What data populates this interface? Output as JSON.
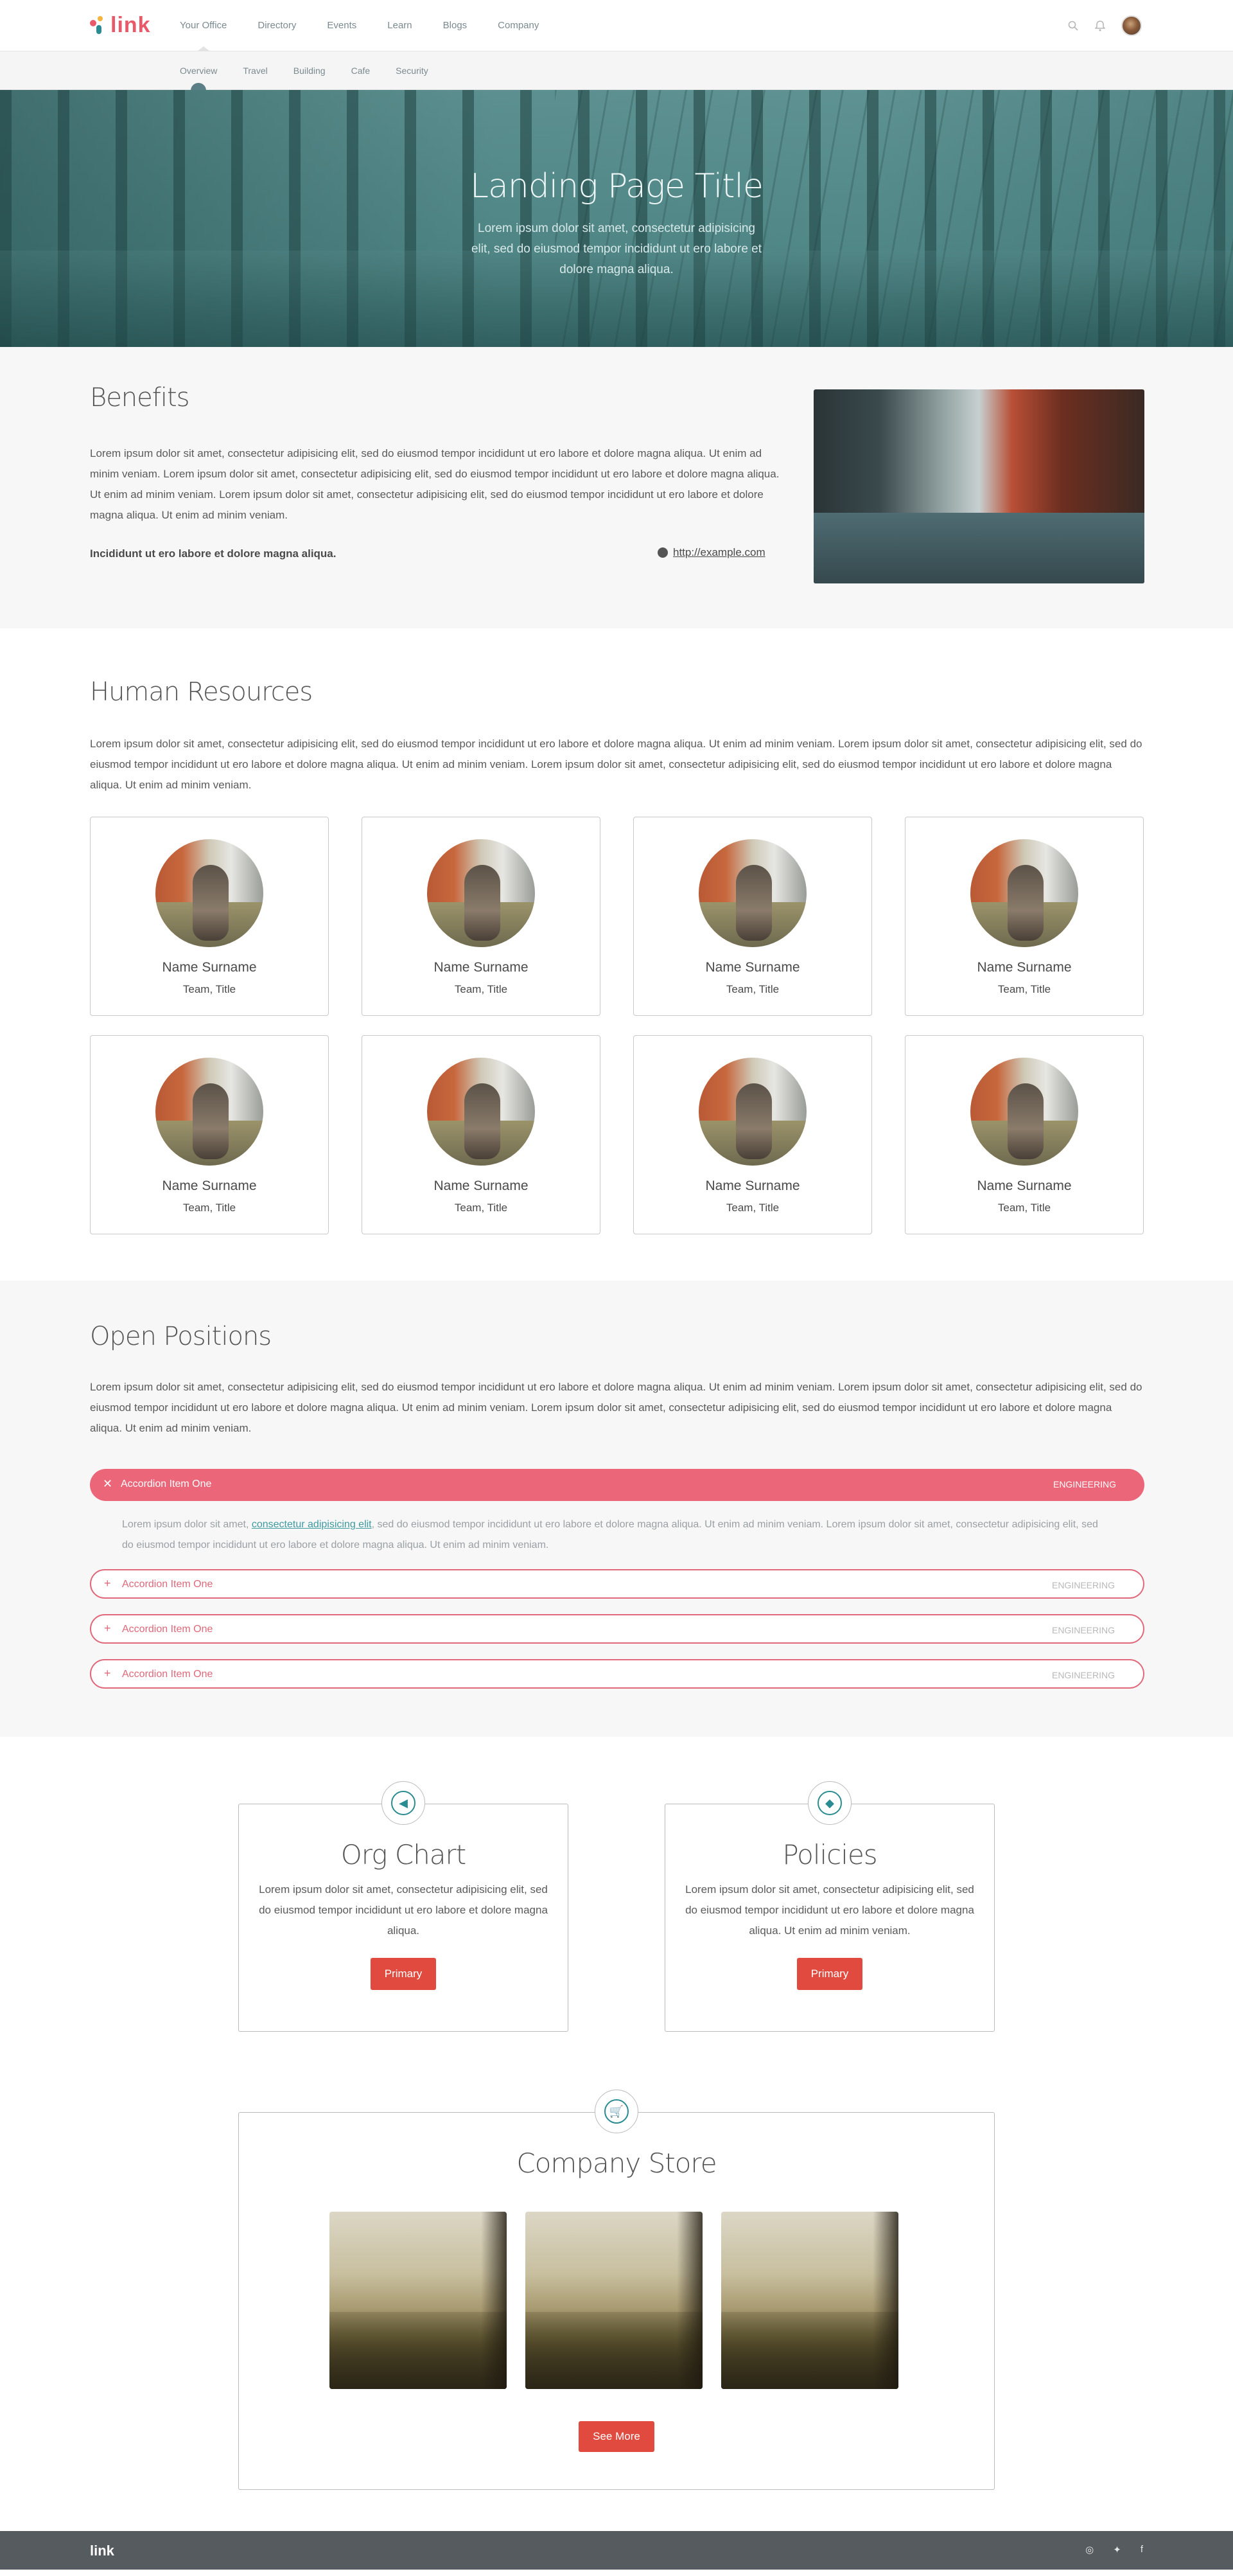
{
  "header": {
    "logo": "link",
    "nav": [
      "Your Office",
      "Directory",
      "Events",
      "Learn",
      "Blogs",
      "Company"
    ],
    "subnav": [
      "Overview",
      "Travel",
      "Building",
      "Cafe",
      "Security"
    ]
  },
  "hero": {
    "title": "Landing Page Title",
    "subtitle": "Lorem ipsum dolor sit amet, consectetur adipisicing elit, sed do eiusmod tempor incididunt ut ero labore et dolore magna aliqua."
  },
  "benefits": {
    "title": "Benefits",
    "text": "Lorem ipsum dolor sit amet, consectetur adipisicing elit, sed do eiusmod tempor incididunt ut ero labore et dolore magna aliqua. Ut enim ad minim veniam. Lorem ipsum dolor sit amet, consectetur adipisicing elit, sed do eiusmod tempor incididunt ut ero labore et dolore magna aliqua. Ut enim ad minim veniam. Lorem ipsum dolor sit amet, consectetur adipisicing elit, sed do eiusmod tempor incididunt ut ero labore et dolore magna aliqua. Ut enim ad minim veniam.",
    "bold": "Incididunt ut ero labore et dolore magna aliqua.",
    "link": "http://example.com"
  },
  "hr": {
    "title": "Human Resources",
    "text": "Lorem ipsum dolor sit amet, consectetur adipisicing elit, sed do eiusmod tempor incididunt ut ero labore et dolore magna aliqua. Ut enim ad minim veniam. Lorem ipsum dolor sit amet, consectetur adipisicing elit, sed do eiusmod tempor incididunt ut ero labore et dolore magna aliqua. Ut enim ad minim veniam. Lorem ipsum dolor sit amet, consectetur adipisicing elit, sed do eiusmod tempor incididunt ut ero labore et dolore magna aliqua. Ut enim ad minim veniam.",
    "people": [
      {
        "name": "Name Surname",
        "title": "Team, Title"
      },
      {
        "name": "Name Surname",
        "title": "Team, Title"
      },
      {
        "name": "Name Surname",
        "title": "Team, Title"
      },
      {
        "name": "Name Surname",
        "title": "Team, Title"
      },
      {
        "name": "Name Surname",
        "title": "Team, Title"
      },
      {
        "name": "Name Surname",
        "title": "Team, Title"
      },
      {
        "name": "Name Surname",
        "title": "Team, Title"
      },
      {
        "name": "Name Surname",
        "title": "Team, Title"
      }
    ]
  },
  "positions": {
    "title": "Open Positions",
    "text": "Lorem ipsum dolor sit amet, consectetur adipisicing elit, sed do eiusmod tempor incididunt ut ero labore et dolore magna aliqua. Ut enim ad minim veniam. Lorem ipsum dolor sit amet, consectetur adipisicing elit, sed do eiusmod tempor incididunt ut ero labore et dolore magna aliqua. Ut enim ad minim veniam. Lorem ipsum dolor sit amet, consectetur adipisicing elit, sed do eiusmod tempor incididunt ut ero labore et dolore magna aliqua. Ut enim ad minim veniam.",
    "items": [
      {
        "label": "Accordion Item One",
        "tag": "ENGINEERING"
      },
      {
        "label": "Accordion Item One",
        "tag": "ENGINEERING"
      },
      {
        "label": "Accordion Item One",
        "tag": "ENGINEERING"
      },
      {
        "label": "Accordion Item One",
        "tag": "ENGINEERING"
      }
    ],
    "body_before": "Lorem ipsum dolor sit amet, ",
    "body_link": "consectetur adipisicing elit",
    "body_after": ", sed do eiusmod tempor incididunt ut ero labore et dolore magna aliqua. Ut enim ad minim veniam. Lorem ipsum dolor sit amet, consectetur adipisicing elit, sed do eiusmod tempor incididunt ut ero labore et dolore magna aliqua. Ut enim ad minim veniam."
  },
  "orgchart": {
    "title": "Org Chart",
    "text": "Lorem ipsum dolor sit amet, consectetur adipisicing elit, sed do eiusmod tempor incididunt ut ero labore et dolore magna aliqua.",
    "button": "Primary",
    "icon": "megaphone-icon"
  },
  "policies": {
    "title": "Policies",
    "text": "Lorem ipsum dolor sit amet, consectetur adipisicing elit, sed do eiusmod tempor incididunt ut ero labore et dolore magna aliqua. Ut enim ad minim veniam.",
    "button": "Primary",
    "icon": "graduation-cap-icon"
  },
  "store": {
    "title": "Company Store",
    "button": "See More",
    "icon": "cart-icon"
  },
  "footer": {
    "logo": "link",
    "icons": [
      "instagram-icon",
      "twitter-icon",
      "facebook-icon"
    ]
  },
  "colors": {
    "accent": "#ea6678",
    "primary_button": "#e04a3f",
    "teal": "#2a8c92"
  }
}
